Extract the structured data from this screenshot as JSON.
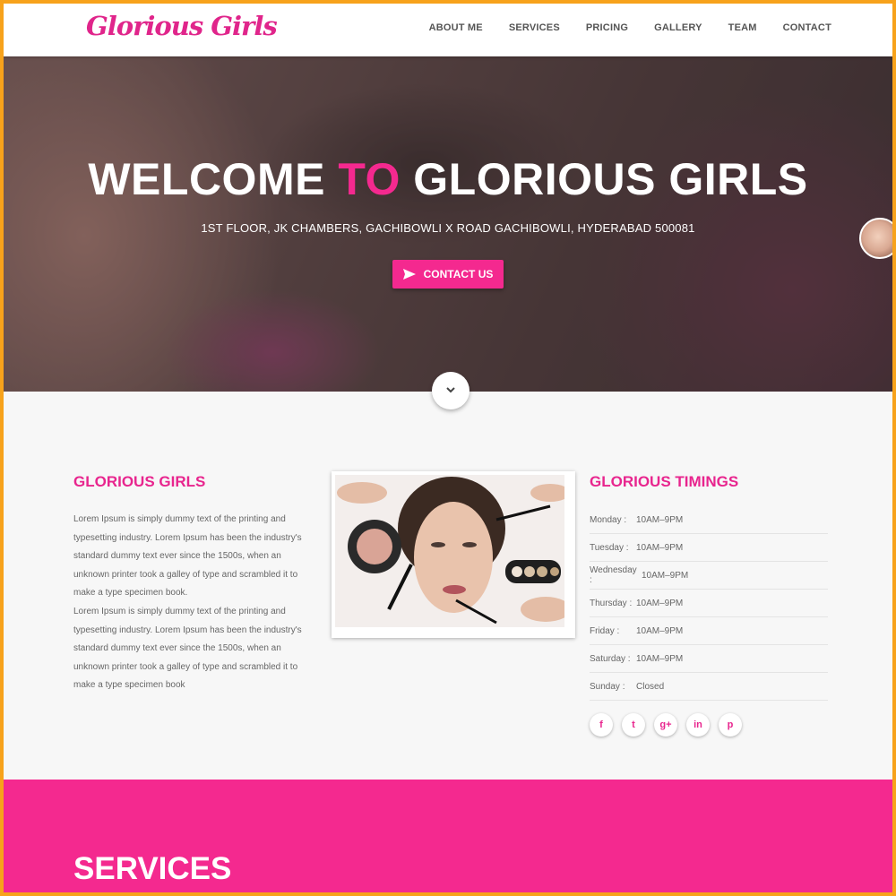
{
  "nav": {
    "logo": "Glorious Girls",
    "links": [
      "ABOUT ME",
      "SERVICES",
      "PRICING",
      "GALLERY",
      "TEAM",
      "CONTACT"
    ]
  },
  "hero": {
    "title_part1": "WELCOME ",
    "title_accent": "TO",
    "title_part2": " GLORIOUS GIRLS",
    "address": "1ST FLOOR, JK CHAMBERS, GACHIBOWLI X ROAD GACHIBOWLI, HYDERABAD 500081",
    "button_label": "CONTACT US"
  },
  "about": {
    "title": "GLORIOUS GIRLS",
    "paragraphs": [
      "Lorem Ipsum is simply dummy text of the printing and typesetting industry. Lorem Ipsum has been the industry's standard dummy text ever since the 1500s, when an unknown printer took a galley of type and scrambled it to make a type specimen book.",
      "Lorem Ipsum is simply dummy text of the printing and typesetting industry. Lorem Ipsum has been the industry's standard dummy text ever since the 1500s, when an unknown printer took a galley of type and scrambled it to make a type specimen book"
    ]
  },
  "timings": {
    "title": "GLORIOUS TIMINGS",
    "rows": [
      {
        "day": "Monday :",
        "hours": "10AM–9PM"
      },
      {
        "day": "Tuesday :",
        "hours": "10AM–9PM"
      },
      {
        "day": "Wednesday :",
        "hours": "10AM–9PM"
      },
      {
        "day": "Thursday :",
        "hours": "10AM–9PM"
      },
      {
        "day": "Friday :",
        "hours": "10AM–9PM"
      },
      {
        "day": "Saturday :",
        "hours": "10AM–9PM"
      },
      {
        "day": "Sunday :",
        "hours": "Closed"
      }
    ]
  },
  "social": [
    {
      "icon": "facebook-icon",
      "glyph": "f"
    },
    {
      "icon": "twitter-icon",
      "glyph": "t"
    },
    {
      "icon": "google-plus-icon",
      "glyph": "g+"
    },
    {
      "icon": "linkedin-icon",
      "glyph": "in"
    },
    {
      "icon": "pinterest-icon",
      "glyph": "p"
    }
  ],
  "services": {
    "title": "SERVICES"
  },
  "colors": {
    "accent": "#f4298f",
    "frame": "#f7a21b"
  }
}
